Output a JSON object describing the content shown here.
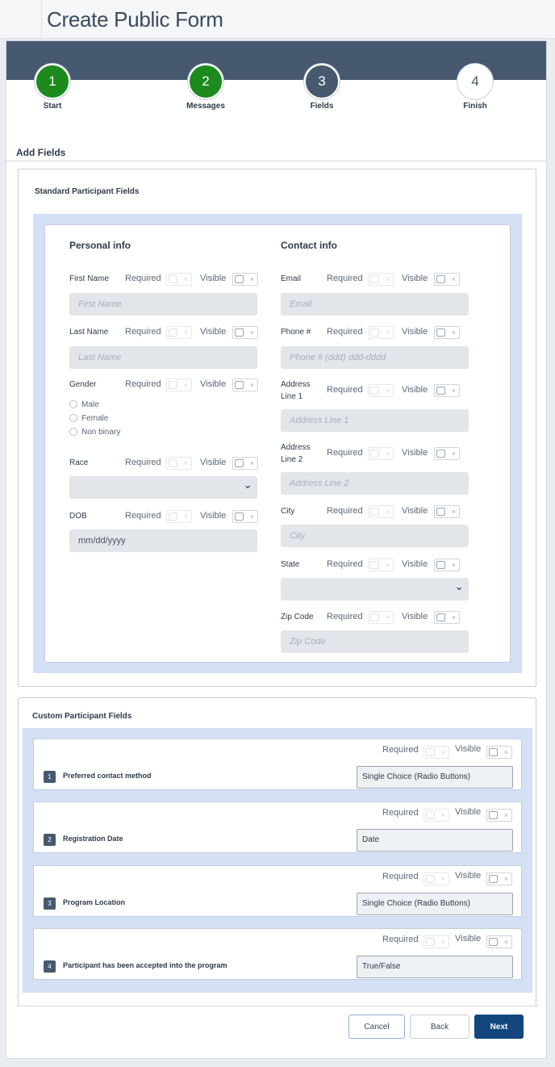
{
  "page": {
    "title": "Create Public Form"
  },
  "steps": [
    {
      "number": "1",
      "label": "Start",
      "status": "done"
    },
    {
      "number": "2",
      "label": "Messages",
      "status": "done"
    },
    {
      "number": "3",
      "label": "Fields",
      "status": "current"
    },
    {
      "number": "4",
      "label": "Finish",
      "status": "todo"
    }
  ],
  "add_fields": {
    "heading": "Add Fields",
    "standard_title": "Standard Participant Fields",
    "required_label": "Required",
    "visible_label": "Visible",
    "personal": {
      "title": "Personal info",
      "first_name": {
        "label": "First Name",
        "placeholder": "First Name"
      },
      "last_name": {
        "label": "Last Name",
        "placeholder": "Last Name"
      },
      "gender": {
        "label": "Gender",
        "options": [
          "Male",
          "Female",
          "Non binary"
        ]
      },
      "race": {
        "label": "Race"
      },
      "dob": {
        "label": "DOB",
        "placeholder": "mm/dd/yyyy"
      }
    },
    "contact": {
      "title": "Contact info",
      "email": {
        "label": "Email",
        "placeholder": "Email"
      },
      "phone": {
        "label": "Phone #",
        "placeholder": "Phone # (ddd) ddd-dddd"
      },
      "address1": {
        "label_1": "Address",
        "label_2": "Line 1",
        "placeholder": "Address Line 1"
      },
      "address2": {
        "label_1": "Address",
        "label_2": "Line 2",
        "placeholder": "Address Line 2"
      },
      "city": {
        "label": "City",
        "placeholder": "City"
      },
      "state": {
        "label": "State"
      },
      "zip": {
        "label": "Zip Code",
        "placeholder": "Zip Code"
      }
    }
  },
  "custom": {
    "title": "Custom Participant Fields",
    "fields": [
      {
        "number": "1",
        "name": "Preferred contact method",
        "type": "Single Choice (Radio Buttons)"
      },
      {
        "number": "2",
        "name": "Registration Date",
        "type": "Date"
      },
      {
        "number": "3",
        "name": "Program Location",
        "type": "Single Choice (Radio Buttons)"
      },
      {
        "number": "4",
        "name": "Participant has been accepted into the program",
        "type": "True/False"
      }
    ]
  },
  "buttons": {
    "cancel": "Cancel",
    "back": "Back",
    "next": "Next"
  },
  "colors": {
    "step_done": "#1c8a1c",
    "step_current": "#47596f",
    "header_band": "#47596f",
    "panel_blue": "#d3e0f6",
    "primary_button": "#12467c"
  }
}
